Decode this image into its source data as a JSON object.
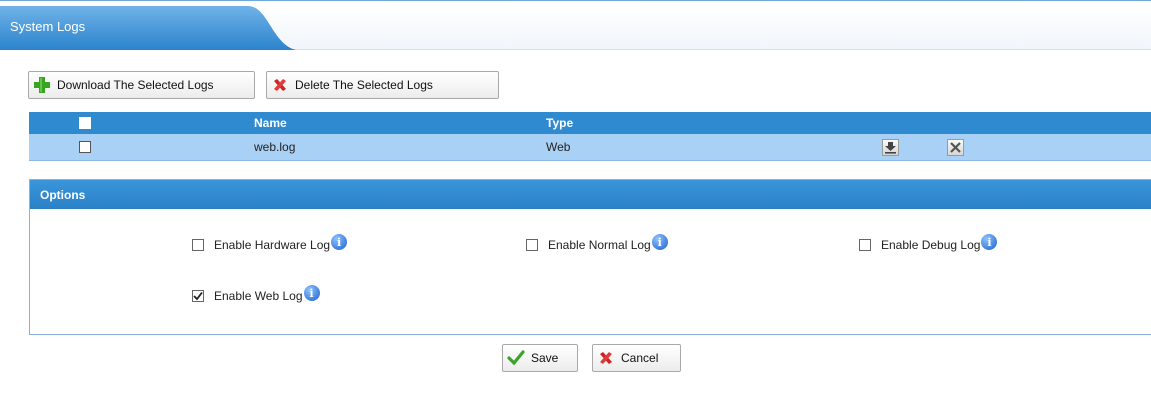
{
  "tab": {
    "title": "System Logs"
  },
  "toolbar": {
    "download_label": "Download The Selected Logs",
    "delete_label": "Delete The Selected Logs"
  },
  "table": {
    "headers": {
      "name": "Name",
      "type": "Type"
    },
    "rows": [
      {
        "name": "web.log",
        "type": "Web",
        "checked": false
      }
    ]
  },
  "options": {
    "title": "Options",
    "hardware_label": "Enable Hardware Log",
    "normal_label": "Enable Normal Log",
    "debug_label": "Enable Debug Log",
    "web_label": "Enable Web Log",
    "hardware_checked": false,
    "normal_checked": false,
    "debug_checked": false,
    "web_checked": true
  },
  "actions": {
    "save_label": "Save",
    "cancel_label": "Cancel"
  },
  "colors": {
    "header_blue": "#2f8ad0",
    "row_blue": "#a9d0f5",
    "tab_blue": "#3d94d8",
    "add_green": "#37a61f",
    "delete_red": "#d42020"
  },
  "icons": {
    "download": "plus-icon",
    "delete": "red-x-icon",
    "row_download": "download-arrow-icon",
    "row_delete": "grey-x-icon",
    "info": "info-icon",
    "save": "checkmark-icon",
    "cancel": "cancel-x-icon"
  }
}
